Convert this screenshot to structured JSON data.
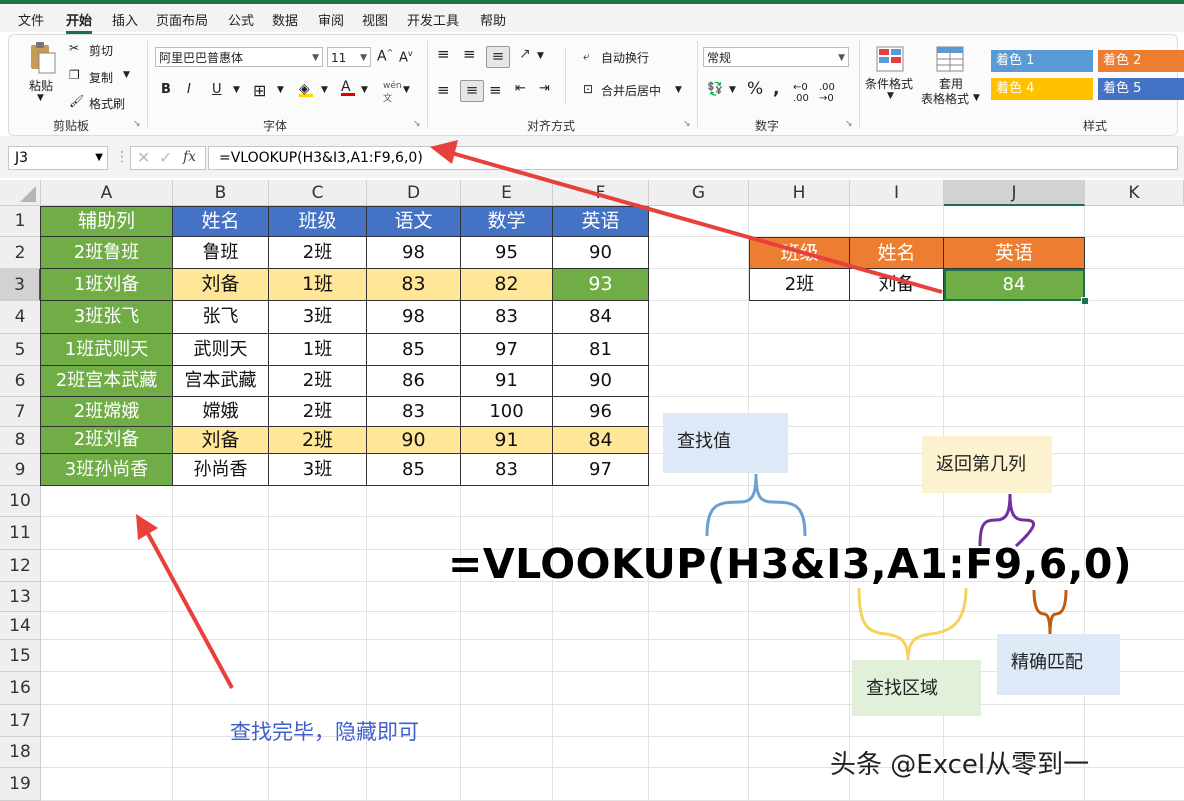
{
  "menu": [
    "文件",
    "开始",
    "插入",
    "页面布局",
    "公式",
    "数据",
    "审阅",
    "视图",
    "开发工具",
    "帮助"
  ],
  "menu_active_index": 1,
  "ribbon": {
    "clipboard": {
      "paste": "粘贴",
      "cut": "剪切",
      "copy": "复制",
      "format_painter": "格式刷",
      "label": "剪贴板"
    },
    "font": {
      "name": "阿里巴巴普惠体",
      "size": "11",
      "bold": "B",
      "italic": "I",
      "underline": "U",
      "label": "字体"
    },
    "alignment": {
      "wrap": "自动换行",
      "merge": "合并后居中",
      "label": "对齐方式"
    },
    "number": {
      "format": "常规",
      "percent": "%",
      "label": "数字"
    },
    "styles": {
      "conditional": "条件格式",
      "table_line1": "套用",
      "table_line2": "表格格式",
      "label": "样式",
      "cells": [
        {
          "text": "着色 1",
          "color": "#5b9bd5"
        },
        {
          "text": "着色 2",
          "color": "#ed7d31"
        },
        {
          "text": "着色 4",
          "color": "#ffc000"
        },
        {
          "text": "着色 5",
          "color": "#4472c4"
        }
      ]
    }
  },
  "formula_bar": {
    "name_box": "J3",
    "fx": "fx",
    "formula": "=VLOOKUP(H3&I3,A1:F9,6,0)"
  },
  "columns": [
    "A",
    "B",
    "C",
    "D",
    "E",
    "F",
    "G",
    "H",
    "I",
    "J",
    "K"
  ],
  "rows": [
    "1",
    "2",
    "3",
    "4",
    "5",
    "6",
    "7",
    "8",
    "9",
    "10",
    "11",
    "12",
    "13",
    "14",
    "15",
    "16",
    "17",
    "18",
    "19"
  ],
  "table": {
    "headers": [
      "辅助列",
      "姓名",
      "班级",
      "语文",
      "数学",
      "英语"
    ],
    "rows": [
      [
        "2班鲁班",
        "鲁班",
        "2班",
        "98",
        "95",
        "90"
      ],
      [
        "1班刘备",
        "刘备",
        "1班",
        "83",
        "82",
        "93"
      ],
      [
        "3班张飞",
        "张飞",
        "3班",
        "98",
        "83",
        "84"
      ],
      [
        "1班武则天",
        "武则天",
        "1班",
        "85",
        "97",
        "81"
      ],
      [
        "2班宫本武藏",
        "宫本武藏",
        "2班",
        "86",
        "91",
        "90"
      ],
      [
        "2班嫦娥",
        "嫦娥",
        "2班",
        "83",
        "100",
        "96"
      ],
      [
        "2班刘备",
        "刘备",
        "2班",
        "90",
        "91",
        "84"
      ],
      [
        "3班孙尚香",
        "孙尚香",
        "3班",
        "85",
        "83",
        "97"
      ]
    ]
  },
  "lookup": {
    "headers": [
      "班级",
      "姓名",
      "英语"
    ],
    "values": [
      "2班",
      "刘备",
      "84"
    ]
  },
  "annotations": {
    "formula": "=VLOOKUP(H3&I3,A1:F9,6,0)",
    "lookup_value": "查找值",
    "return_column": "返回第几列",
    "lookup_range": "查找区域",
    "exact_match": "精确匹配",
    "hide_note": "查找完毕，隐藏即可",
    "watermark": "头条 @Excel从零到一"
  },
  "colors": {
    "helper_green": "#70ad47",
    "header_blue": "#4472c4",
    "highlight_yellow": "#ffe699",
    "lookup_orange": "#ed7d31",
    "arrow_red": "#e8403a"
  }
}
